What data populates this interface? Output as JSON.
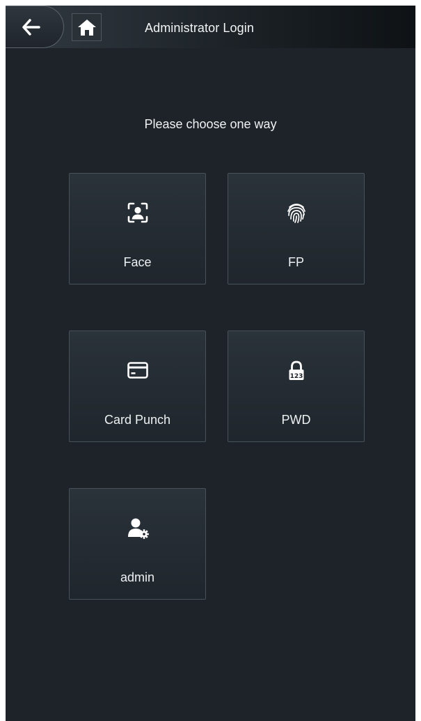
{
  "header": {
    "title": "Administrator Login",
    "back_icon": "arrow-left-icon",
    "home_icon": "home-icon"
  },
  "main": {
    "prompt": "Please choose one way",
    "methods": [
      {
        "label": "Face",
        "icon": "face-recognition-icon"
      },
      {
        "label": "FP",
        "icon": "fingerprint-icon"
      },
      {
        "label": "Card Punch",
        "icon": "card-icon"
      },
      {
        "label": "PWD",
        "icon": "password-lock-icon"
      },
      {
        "label": "admin",
        "icon": "user-settings-icon"
      }
    ]
  },
  "colors": {
    "background": "#1d2329",
    "tile_border": "#4a5259",
    "text": "#eef1f3"
  }
}
